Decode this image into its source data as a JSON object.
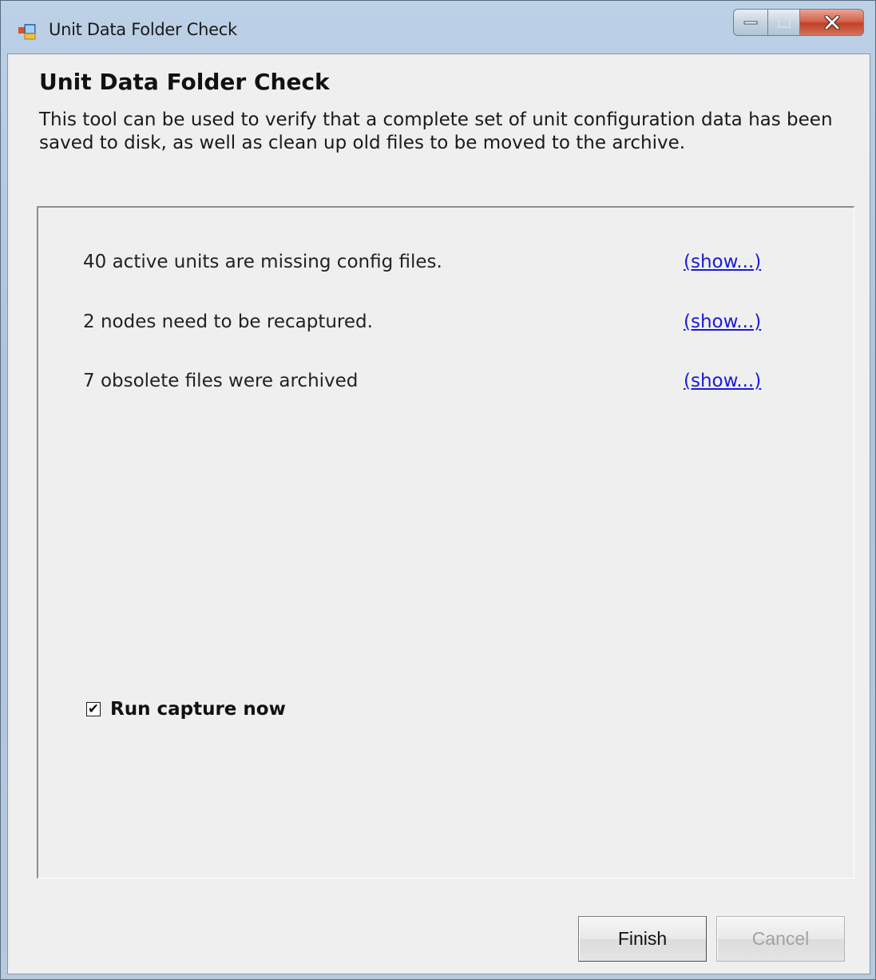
{
  "window": {
    "title": "Unit Data Folder Check",
    "caption_buttons": [
      "minimize",
      "maximize",
      "close"
    ]
  },
  "content": {
    "heading": "Unit Data Folder Check",
    "description": "This tool can be used to verify that a complete set of unit configuration data has been saved to disk, as well as clean up old files to be moved to the archive."
  },
  "results": [
    {
      "text": "40 active units are missing config files.",
      "link": "(show...)"
    },
    {
      "text": "2 nodes need to be recaptured.",
      "link": "(show...)"
    },
    {
      "text": "7 obsolete files were archived",
      "link": "(show...)"
    }
  ],
  "options": {
    "run_capture": {
      "label": "Run capture now",
      "checked": true
    }
  },
  "buttons": {
    "finish": "Finish",
    "cancel": "Cancel",
    "cancel_enabled": false
  },
  "icons": {
    "window": "app-window-icon",
    "close": "close-icon",
    "minimize": "minimize-icon",
    "maximize": "maximize-icon"
  },
  "colors": {
    "link": "#1a1ad6",
    "close_button": "#c24226"
  }
}
